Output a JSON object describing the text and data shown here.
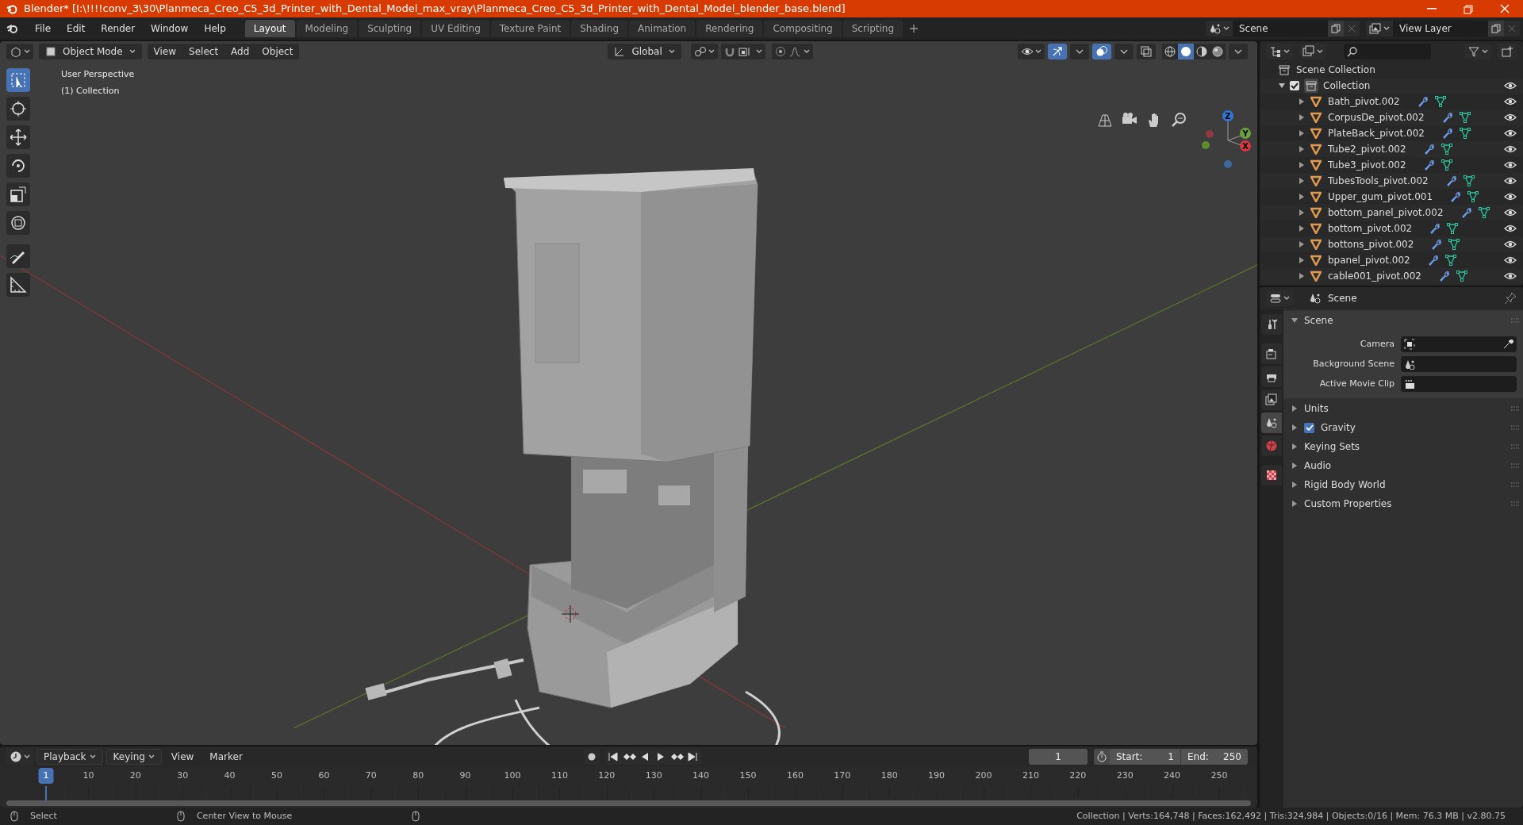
{
  "window": {
    "title": "Blender* [I:\\!!!!conv_3\\30\\Planmeca_Creo_C5_3d_Printer_with_Dental_Model_max_vray\\Planmeca_Creo_C5_3d_Printer_with_Dental_Model_blender_base.blend]"
  },
  "menu": [
    "File",
    "Edit",
    "Render",
    "Window",
    "Help"
  ],
  "workspaces": [
    {
      "label": "Layout",
      "selected": true
    },
    {
      "label": "Modeling",
      "selected": false
    },
    {
      "label": "Sculpting",
      "selected": false
    },
    {
      "label": "UV Editing",
      "selected": false
    },
    {
      "label": "Texture Paint",
      "selected": false
    },
    {
      "label": "Shading",
      "selected": false
    },
    {
      "label": "Animation",
      "selected": false
    },
    {
      "label": "Rendering",
      "selected": false
    },
    {
      "label": "Compositing",
      "selected": false
    },
    {
      "label": "Scripting",
      "selected": false
    }
  ],
  "scene_field": "Scene",
  "view_layer_field": "View Layer",
  "viewport_header": {
    "mode": "Object Mode",
    "menus": [
      "View",
      "Select",
      "Add",
      "Object"
    ],
    "orientation": "Global",
    "snap": {
      "on": false
    },
    "proportional_edit": {
      "on": false
    },
    "shading": [
      {
        "selected": false
      },
      {
        "selected": true
      },
      {
        "selected": false
      },
      {
        "selected": false
      }
    ]
  },
  "viewport": {
    "overlay_texts": [
      "User Perspective",
      "(1) Collection"
    ],
    "tools": [
      {
        "kind": "select",
        "selected": true
      },
      {
        "kind": "cursor",
        "selected": false
      },
      {
        "kind": "move",
        "selected": false
      },
      {
        "kind": "rotate",
        "selected": false
      },
      {
        "kind": "scale",
        "selected": false
      },
      {
        "kind": "transform",
        "selected": false
      },
      {
        "kind": "annotate",
        "selected": false
      },
      {
        "kind": "measure",
        "selected": false
      }
    ],
    "gizmo_axes": [
      "Z",
      "Y",
      "X"
    ]
  },
  "outliner": {
    "root": "Scene Collection",
    "collection": {
      "label": "Collection",
      "checked": true,
      "expanded": true,
      "children": [
        {
          "label": "Bath_pivot.002"
        },
        {
          "label": "CorpusDe_pivot.002"
        },
        {
          "label": "PlateBack_pivot.002"
        },
        {
          "label": "Tube2_pivot.002"
        },
        {
          "label": "Tube3_pivot.002"
        },
        {
          "label": "TubesTools_pivot.002"
        },
        {
          "label": "Upper_gum_pivot.001"
        },
        {
          "label": "bottom_panel_pivot.002"
        },
        {
          "label": "bottom_pivot.002"
        },
        {
          "label": "bottons_pivot.002"
        },
        {
          "label": "bpanel_pivot.002"
        },
        {
          "label": "cable001_pivot.002"
        }
      ]
    }
  },
  "properties": {
    "context": "Scene",
    "tabs": [
      {
        "kind": "tool",
        "selected": false
      },
      {
        "kind": "render",
        "selected": false
      },
      {
        "kind": "output",
        "selected": false
      },
      {
        "kind": "view_layer",
        "selected": false
      },
      {
        "kind": "scene",
        "selected": true
      },
      {
        "kind": "world",
        "selected": false
      },
      {
        "kind": "texture",
        "selected": false
      }
    ],
    "panels": [
      {
        "label": "Scene",
        "expanded": true,
        "fields": [
          {
            "label": "Camera",
            "kind": "camera"
          },
          {
            "label": "Background Scene",
            "kind": "scene"
          },
          {
            "label": "Active Movie Clip",
            "kind": "clip"
          }
        ]
      },
      {
        "label": "Units",
        "expanded": false
      },
      {
        "label": "Gravity",
        "expanded": false,
        "checked": true
      },
      {
        "label": "Keying Sets",
        "expanded": false
      },
      {
        "label": "Audio",
        "expanded": false
      },
      {
        "label": "Rigid Body World",
        "expanded": false
      },
      {
        "label": "Custom Properties",
        "expanded": false
      }
    ]
  },
  "timeline": {
    "menus": [
      "Playback",
      "Keying",
      "View",
      "Marker"
    ],
    "current_frame": "1",
    "start_label": "Start:",
    "start": "1",
    "end_label": "End:",
    "end": "250",
    "playhead": "1",
    "ruler": [
      "10",
      "20",
      "30",
      "40",
      "50",
      "60",
      "70",
      "80",
      "90",
      "100",
      "110",
      "120",
      "130",
      "140",
      "150",
      "160",
      "170",
      "180",
      "190",
      "200",
      "210",
      "220",
      "230",
      "240",
      "250"
    ]
  },
  "status_bar": {
    "hints": [
      "Select",
      "Center View to Mouse"
    ],
    "stats": "Collection | Verts:164,748 | Faces:162,492 | Tris:324,984 | Objects:0/16 | Mem: 76.3 MB | v2.80.75"
  }
}
